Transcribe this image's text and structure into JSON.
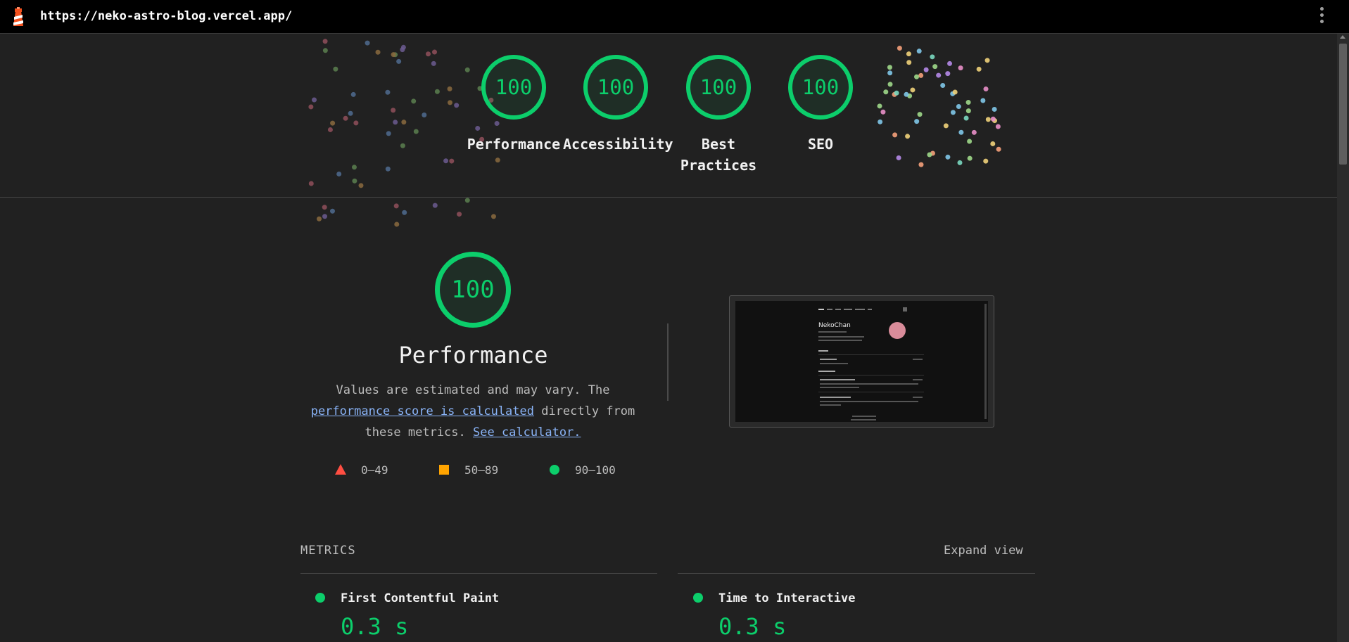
{
  "topbar": {
    "url": "https://neko-astro-blog.vercel.app/"
  },
  "categories": [
    {
      "score": "100",
      "label": "Performance"
    },
    {
      "score": "100",
      "label": "Accessibility"
    },
    {
      "score": "100",
      "label": "Best Practices"
    },
    {
      "score": "100",
      "label": "SEO"
    }
  ],
  "performance": {
    "score": "100",
    "title": "Performance",
    "desc_prefix": "Values are estimated and may vary. The ",
    "link1": "performance score is calculated",
    "desc_mid": " directly from these metrics. ",
    "link2": "See calculator."
  },
  "legend": [
    {
      "range": "0–49",
      "color": "#ff4e42",
      "shape": "triangle"
    },
    {
      "range": "50–89",
      "color": "#ffa400",
      "shape": "square"
    },
    {
      "range": "90–100",
      "color": "#0cce6b",
      "shape": "circle"
    }
  ],
  "thumbnail": {
    "site_name": "NekoChan"
  },
  "metrics": {
    "heading": "METRICS",
    "expand_label": "Expand view",
    "items": [
      {
        "title": "First Contentful Paint",
        "value": "0.3 s"
      },
      {
        "title": "Time to Interactive",
        "value": "0.3 s"
      }
    ]
  },
  "colors": {
    "pass": "#0cce6b",
    "average": "#ffa400",
    "fail": "#ff4e42",
    "link": "#8ab4f8"
  }
}
